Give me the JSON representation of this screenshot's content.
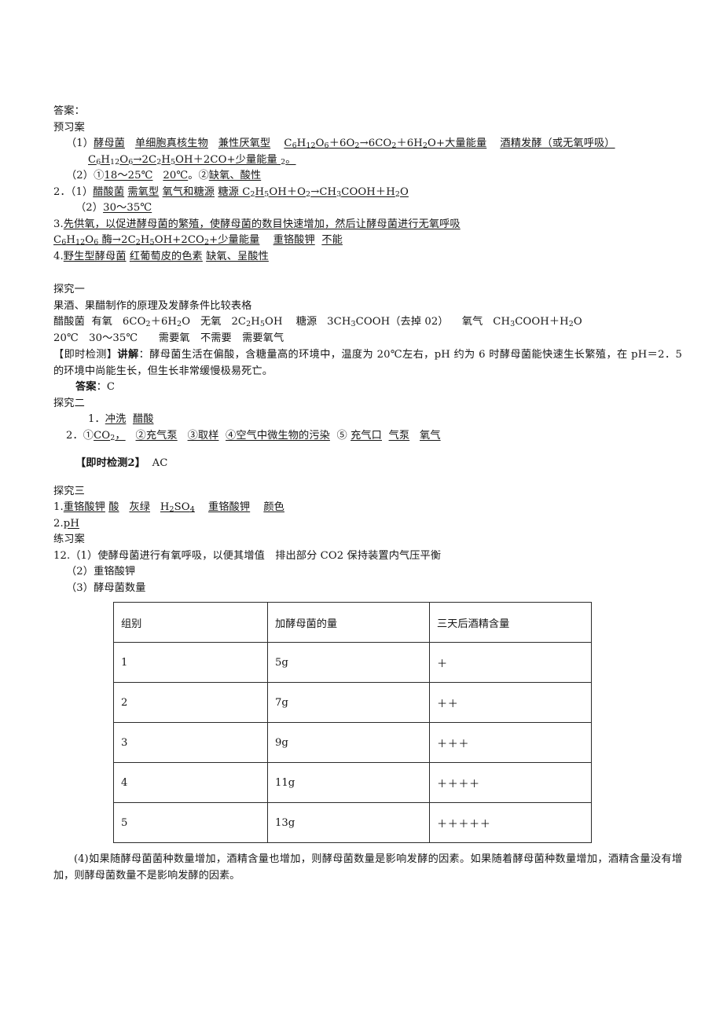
{
  "document": {
    "title": "答案：",
    "sections": {
      "yuxi": {
        "heading": "预习案",
        "line1_prefix": "（1）",
        "line1_items": [
          "酵母菌",
          "单细胞真核生物",
          "兼性厌氧型"
        ],
        "line1_eq": "C6H12O6＋6O2→6CO2＋6H2O+大量能量",
        "line1_tail": "酒精发酵（或无氧呼吸）",
        "line2_eq": "C6H12O6→2C2H5OH＋2CO+少量能量 2。",
        "line3_prefix": "（2）①",
        "line3_a": "18～25℃",
        "line3_b": "20℃",
        "line3_mid": "。②",
        "line3_c": "缺氧、酸性",
        "line4_prefix": "2．（1）",
        "line4_items": [
          "醋酸菌",
          "需氧型",
          "氧气和糖源"
        ],
        "line4_eq": "糖源 C2H5OH＋O2→CH3COOH＋H2O",
        "line5_prefix": "（2）",
        "line5_val": "30～35℃",
        "line6_prefix": "3.",
        "line6_text": "先供氧，以促进酵母菌的繁殖，使酵母菌的数目快速增加，然后让酵母菌进行无氧呼吸",
        "line7_eq": "C6H12O6 酶→2C2H5OH+2CO2+少量能量",
        "line7_b": "重铬酸钾",
        "line7_c": "不能",
        "line8_prefix": "4.",
        "line8_items": [
          "野生型酵母菌",
          "红葡萄皮的色素",
          "缺氧、呈酸性"
        ]
      },
      "tanjiu1": {
        "heading": "探究一",
        "subtitle": "果酒、果醋制作的原理及发酵条件比较表格",
        "row1": "醋酸菌　有氧　6CO2＋6H2O　无氧　2C2H5OH　　糖源　3CH3COOH（去掉 02）　　氧气　CH3COOH＋H2O",
        "row2": "20℃　30～35℃　　需要氧　不需要　需要氧气",
        "detect_label": "【即时检测】",
        "detect_bold": "讲解",
        "detect_text": "：酵母菌生活在偏酸，含糖量高的环境中，温度为 20℃左右，pH 约为 6 时酵母菌能快速生长繁殖，在 pH＝2．5 的环境中尚能生长，但生长非常缓慢极易死亡。",
        "answer_label": "答案",
        "answer_value": "：C"
      },
      "tanjiu2": {
        "heading": "探究二",
        "item1_num": "1．",
        "item1_a": "冲洗",
        "item1_b": "醋酸",
        "item2_num": "2．",
        "item2_parts": [
          "①CO2，",
          "②充气泵",
          "③取样",
          "④空气中微生物的污染",
          "⑤",
          "充气口",
          "气泵",
          "氧气"
        ],
        "detect2_label": "【即时检测2】",
        "detect2_value": "AC"
      },
      "tanjiu3": {
        "heading": "探究三",
        "item1_num": "1.",
        "item1_parts": [
          "重铬酸钾",
          "酸",
          "灰绿",
          "H2SO4",
          "重铬酸钾",
          "颜色"
        ],
        "item2_num": "2.",
        "item2_value": "pH"
      },
      "lianxi": {
        "heading": "练习案",
        "q12_1": "12.（1）使酵母菌进行有氧呼吸，以便其增值　排出部分 CO2 保持装置内气压平衡",
        "q12_2": "（2）重铬酸钾",
        "q12_3": "（3）酵母菌数量",
        "q12_4_first": "(4)如果随酵母菌菌种数量增加，酒精含量也增加，则酵母菌数量是影响发酵的因素。如果随着酵母菌种数",
        "q12_4_second": "量增加，酒精含量没有增加，则酵母菌数量不是影响发酵的因素。"
      }
    },
    "table": {
      "headers": [
        "组别",
        "加酵母菌的量",
        "三天后酒精含量"
      ],
      "rows": [
        [
          "1",
          "5g",
          "＋"
        ],
        [
          "2",
          "7g",
          "＋＋"
        ],
        [
          "3",
          "9g",
          "＋＋＋"
        ],
        [
          "4",
          "11g",
          "＋＋＋＋"
        ],
        [
          "5",
          "13g",
          "＋＋＋＋＋"
        ]
      ]
    }
  }
}
